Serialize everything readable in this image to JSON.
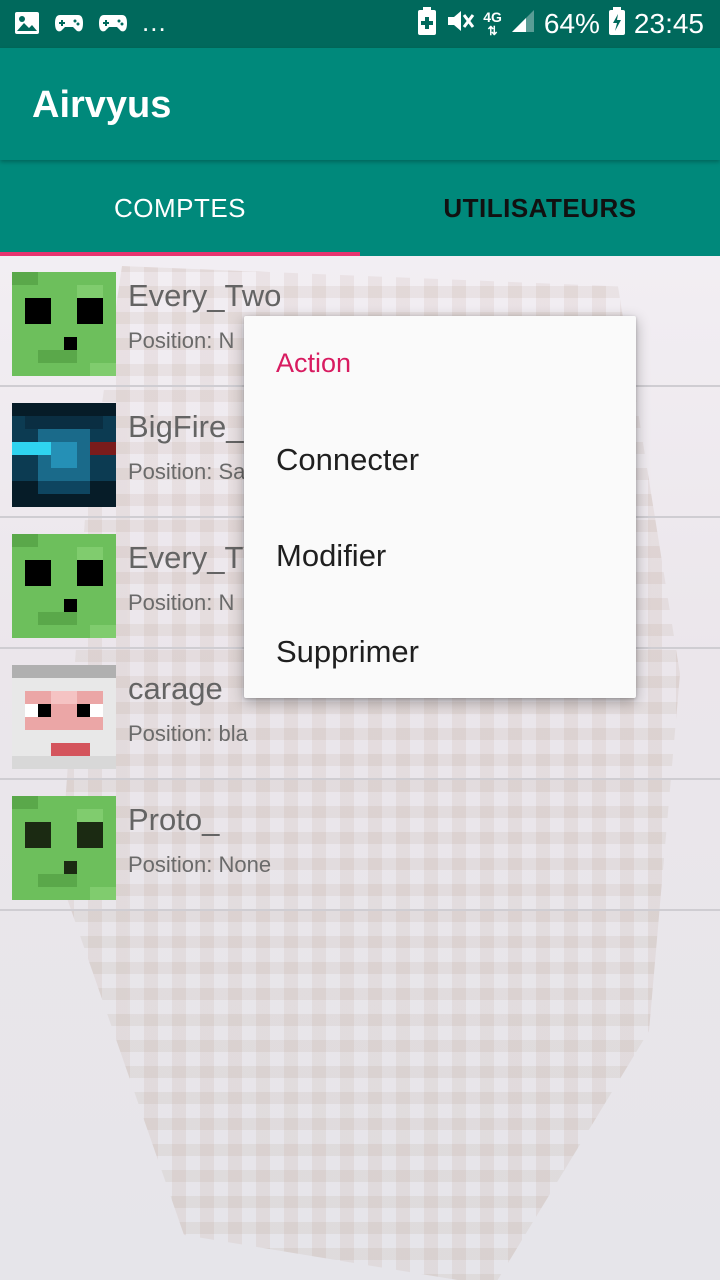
{
  "status_bar": {
    "notification_icons": [
      "image-icon",
      "gamepad-icon",
      "gamepad-icon"
    ],
    "more": "...",
    "network": "4G",
    "battery": "64%",
    "time": "23:45"
  },
  "app": {
    "title": "Airvyus"
  },
  "tabs": [
    {
      "label": "COMPTES",
      "selected": true
    },
    {
      "label": "UTILISATEURS",
      "selected": false
    }
  ],
  "accounts": [
    {
      "name": "Every_Two",
      "position": "Position: N",
      "avatar": "green-slime-face"
    },
    {
      "name": "BigFire_",
      "position": "Position: Sa",
      "avatar": "blue-face"
    },
    {
      "name": "Every_TV",
      "position": "Position: N",
      "avatar": "green-slime-face"
    },
    {
      "name": "carage",
      "position": "Position: bla",
      "avatar": "white-face"
    },
    {
      "name": "Proto_",
      "position": "Position: None",
      "avatar": "green-slime-face"
    }
  ],
  "popup": {
    "title": "Action",
    "items": [
      "Connecter",
      "Modifier",
      "Supprimer"
    ]
  },
  "colors": {
    "status_bar": "#00695c",
    "primary": "#00897b",
    "accent": "#e8336f",
    "popup_title": "#d81b60"
  }
}
